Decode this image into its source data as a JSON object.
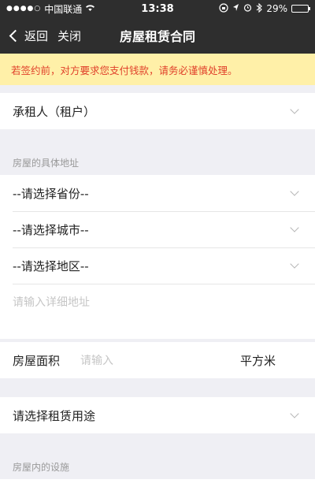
{
  "statusbar": {
    "carrier": "中国联通",
    "time": "13:38",
    "battery": "29%",
    "battery_level": 0.29
  },
  "nav": {
    "back_label": "返回",
    "close_label": "关闭",
    "title": "房屋租赁合同"
  },
  "warning": "若签约前，对方要求您支付钱款，请务必谨慎处理。",
  "tenant": {
    "label": "承租人（租户）"
  },
  "address": {
    "caption": "房屋的具体地址",
    "province": "--请选择省份--",
    "city": "--请选择城市--",
    "district": "--请选择地区--",
    "detail_placeholder": "请输入详细地址"
  },
  "area": {
    "label": "房屋面积",
    "placeholder": "请输入",
    "unit": "平方米"
  },
  "usage": {
    "label": "请选择租赁用途"
  },
  "facilities": {
    "caption": "房屋内的设施"
  }
}
